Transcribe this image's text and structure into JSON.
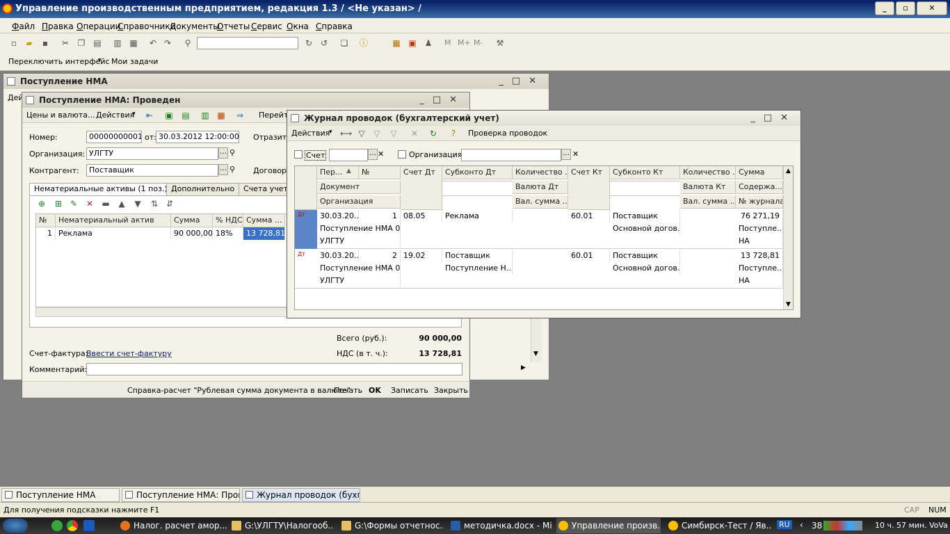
{
  "app": {
    "title": "Управление производственным предприятием, редакция 1.3 / <Не указан> /",
    "minimize": "_",
    "maximize": "▫",
    "close": "✕"
  },
  "menu": [
    "Файл",
    "Правка",
    "Операции",
    "Справочники",
    "Документы",
    "Отчеты",
    "Сервис",
    "Окна",
    "Справка"
  ],
  "toolbar2": {
    "switch": "Переключить интерфейс",
    "tasks": "Мои задачи",
    "m": "M",
    "mplus": "M+",
    "mminus": "M-"
  },
  "win_back": {
    "title": "Поступление НМА",
    "trunc": "Дей"
  },
  "doc": {
    "title": "Поступление НМА: Проведен",
    "btn_prices": "Цены и валюта...",
    "btn_actions": "Действия",
    "btn_go": "Перейт",
    "number_label": "Номер:",
    "number": "00000000001",
    "from_label": "от:",
    "date": "30.03.2012 12:00:00",
    "reflect": "Отразить",
    "org_label": "Организация:",
    "org": "УЛГТУ",
    "contr_label": "Контрагент:",
    "contr": "Поставщик",
    "contract_label": "Договор:",
    "tabs": [
      "Нематериальные активы (1 поз.)",
      "Дополнительно",
      "Счета учета"
    ],
    "cols": [
      "№",
      "Нематериальный актив",
      "Сумма",
      "% НДС",
      "Сумма ..."
    ],
    "row": [
      "1",
      "Реклама",
      "90 000,00",
      "18%",
      "13 728,81"
    ],
    "total_label": "Всего (руб.):",
    "total": "90 000,00",
    "vat_label": "НДС (в т. ч.):",
    "vat": "13 728,81",
    "invoice_label": "Счет-фактура:",
    "invoice_link": "Ввести счет-фактуру",
    "comment_label": "Комментарий:",
    "bottom": [
      "Справка-расчет \"Рублевая сумма документа в валюте\"",
      "Печать",
      "OK",
      "Записать",
      "Закрыть"
    ]
  },
  "journal": {
    "title": "Журнал проводок (бухгалтерский учет)",
    "actions": "Действия",
    "check": "Проверка проводок",
    "f_account": "Счет",
    "f_org": "Организация:",
    "h1": [
      "Пер...",
      "№",
      "Счет Дт",
      "Субконто Дт",
      "Количество ...",
      "Счет Кт",
      "Субконто Кт",
      "Количество ...",
      "Сумма"
    ],
    "h2": [
      "Документ",
      "Валюта Дт",
      "Валюта Кт",
      "Содержа..."
    ],
    "h3": [
      "Организация",
      "Вал. сумма ...",
      "Вал. сумма ...",
      "№ журнала"
    ],
    "rows": [
      {
        "date": "30.03.20...",
        "n": "1",
        "dt": "08.05",
        "subdt": "Реклама",
        "kt": "60.01",
        "subkt": "Поставщик",
        "sum": "76 271,19",
        "doc": "Поступление НМА 0...",
        "subdt2": "",
        "subkt2": "Основной догов...",
        "cont": "Поступле...",
        "org": "УЛГТУ",
        "jn": "НА"
      },
      {
        "date": "30.03.20...",
        "n": "2",
        "dt": "19.02",
        "subdt": "Поставщик",
        "kt": "60.01",
        "subkt": "Поставщик",
        "sum": "13 728,81",
        "doc": "Поступление НМА 0...",
        "subdt2": "Поступление Н...",
        "subkt2": "Основной догов...",
        "cont": "Поступле...",
        "org": "УЛГТУ",
        "jn": "НА"
      }
    ]
  },
  "wintabs": [
    "Поступление НМА",
    "Поступление НМА: Проведен",
    "Журнал проводок (бухгалте..."
  ],
  "status": {
    "hint": "Для получения подсказки нажмите F1",
    "cap": "CAP",
    "num": "NUM"
  },
  "taskbar": {
    "items": [
      "Налог. расчет амор...",
      "G:\\УЛГТУ\\Налогооб...",
      "G:\\Формы отчетнос...",
      "методичка.docx - Mi...",
      "Управление произв...",
      "Симбирск-Тест / Яв..."
    ],
    "lang": "RU",
    "tray_num": "38",
    "clock": "10 ч. 57 мин. VoVa",
    "colors": {
      "firefox": "#e87020",
      "folder": "#e8c060",
      "word": "#2a5caa",
      "onec": "#f8c000"
    }
  }
}
